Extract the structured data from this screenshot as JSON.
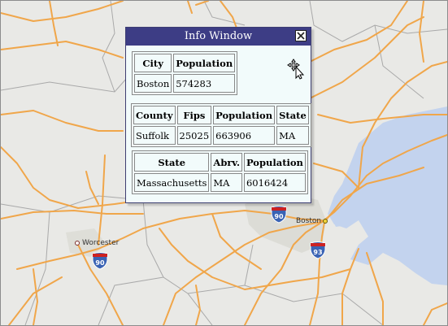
{
  "info_window": {
    "title": "Info Window",
    "city_table": {
      "headers": [
        "City",
        "Population"
      ],
      "row": [
        "Boston",
        "574283"
      ]
    },
    "county_table": {
      "headers": [
        "County",
        "Fips",
        "Population",
        "State"
      ],
      "row": [
        "Suffolk",
        "25025",
        "663906",
        "MA"
      ]
    },
    "state_table": {
      "headers": [
        "State",
        "Abrv.",
        "Population"
      ],
      "row": [
        "Massachusetts",
        "MA",
        "6016424"
      ]
    }
  },
  "map": {
    "places": [
      {
        "name": "Worcester"
      },
      {
        "name": "Boston"
      }
    ],
    "shields": [
      {
        "route": "90"
      },
      {
        "route": "90"
      },
      {
        "route": "93"
      }
    ],
    "colors": {
      "land": "#e9e9e6",
      "water": "#c3d3ee",
      "road": "#f0a64a",
      "boundary": "#a9a9a9",
      "urban": "#dcdcd6"
    }
  }
}
